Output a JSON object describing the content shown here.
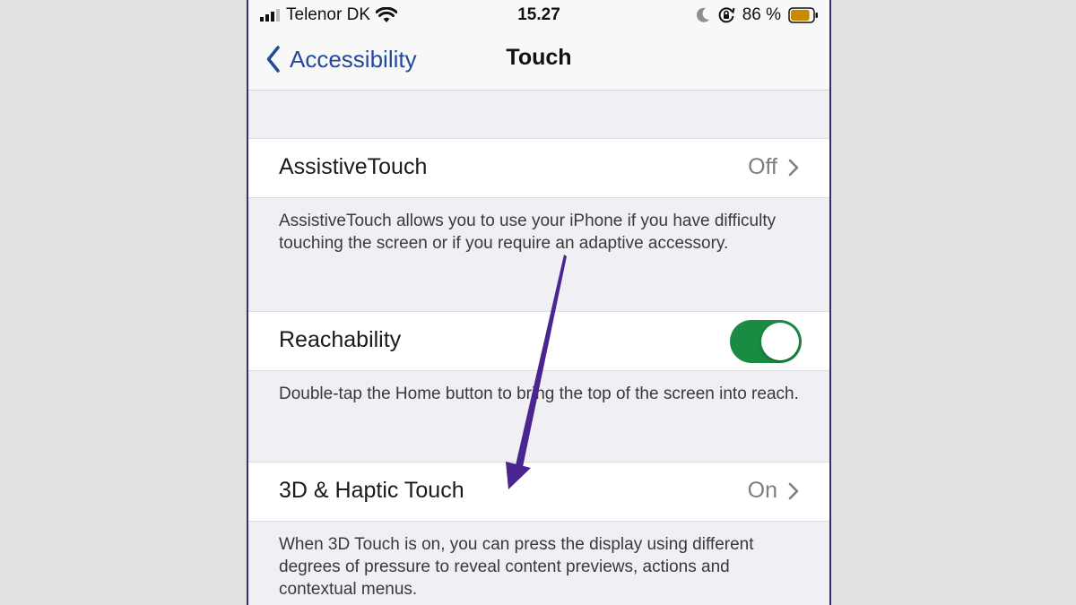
{
  "status_bar": {
    "carrier": "Telenor DK",
    "time": "15.27",
    "battery_percent_text": "86 %",
    "battery_level": 0.86,
    "icons": [
      "signal-bars-icon",
      "wifi-icon",
      "moon-icon",
      "orientation-lock-icon",
      "battery-icon"
    ]
  },
  "nav": {
    "back_label": "Accessibility",
    "title": "Touch"
  },
  "rows": {
    "assistive": {
      "label": "AssistiveTouch",
      "value": "Off",
      "description": "AssistiveTouch allows you to use your iPhone if you have difficulty touching the screen or if you require an adaptive accessory."
    },
    "reachability": {
      "label": "Reachability",
      "toggle_on": true,
      "description": "Double-tap the Home button to bring the top of the screen into reach."
    },
    "haptic": {
      "label": "3D & Haptic Touch",
      "value": "On",
      "description": "When 3D Touch is on, you can press the display using different degrees of pressure to reveal content previews, actions and contextual menus."
    }
  },
  "colors": {
    "accent": "#23499b",
    "toggle_on": "#1a8b43",
    "annotation_arrow": "#4a248f",
    "battery_fill": "#c98a00"
  }
}
